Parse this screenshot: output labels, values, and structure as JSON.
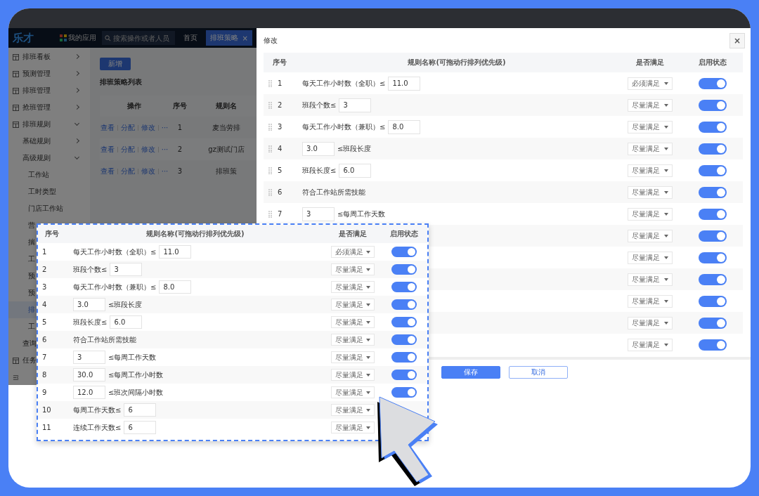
{
  "app": {
    "logo": "乐才",
    "apps_label": "我的应用",
    "search": {
      "placeholder": "搜索操作或者人员"
    },
    "nav_tabs": [
      {
        "label": "首页",
        "selected": false
      },
      {
        "label": "排班策略",
        "selected": true,
        "close": "×"
      }
    ],
    "sidebar": [
      {
        "label": "排班看板",
        "expanded": false
      },
      {
        "label": "预测管理",
        "expanded": false
      },
      {
        "label": "排班管理",
        "expanded": false
      },
      {
        "label": "抢班管理",
        "expanded": false
      },
      {
        "label": "排班规则",
        "expanded": true,
        "children": [
          {
            "label": "基础规则",
            "expanded": false
          },
          {
            "label": "高级规则",
            "expanded": true,
            "children": [
              {
                "label": "工作站",
                "selected": false
              },
              {
                "label": "工时类型",
                "selected": false
              },
              {
                "label": "门店工作站",
                "selected": false
              },
              {
                "label": "营",
                "selected": false
              },
              {
                "label": "揣",
                "selected": false
              },
              {
                "label": "工",
                "selected": false
              },
              {
                "label": "预",
                "selected": false
              },
              {
                "label": "预",
                "selected": false
              },
              {
                "label": "排",
                "selected": true
              },
              {
                "label": "工",
                "selected": false
              }
            ]
          },
          {
            "label": "查询"
          }
        ]
      },
      {
        "label": "任务"
      }
    ],
    "new_button": "新增",
    "list_title": "排班策略列表",
    "table": {
      "columns": [
        "操作",
        "序号",
        "规则名"
      ],
      "rows": [
        {
          "actions": [
            "查看",
            "分配",
            "修改",
            "···"
          ],
          "index": "1",
          "name": "麦当劳排"
        },
        {
          "actions": [
            "查看",
            "分配",
            "修改",
            "···"
          ],
          "index": "2",
          "name": "gz测试门店"
        },
        {
          "actions": [
            "查看",
            "分配",
            "修改",
            "···"
          ],
          "index": "3",
          "name": "排班策"
        }
      ]
    }
  },
  "modal": {
    "title": "修改",
    "close": "×",
    "columns": [
      "序号",
      "规则名称(可拖动行排列优先级)",
      "是否满足",
      "启用状态"
    ],
    "rows": [
      {
        "index": "1",
        "name": [
          {
            "kind": "text",
            "text": "每天工作小时数（全职）≤"
          },
          {
            "kind": "input",
            "text": "11.0"
          }
        ],
        "satisfy": "必须满足",
        "enabled": true
      },
      {
        "index": "2",
        "name": [
          {
            "kind": "text",
            "text": "班段个数≤"
          },
          {
            "kind": "input",
            "text": "3"
          }
        ],
        "satisfy": "尽量满足",
        "enabled": true
      },
      {
        "index": "3",
        "name": [
          {
            "kind": "text",
            "text": "每天工作小时数（兼职）≤"
          },
          {
            "kind": "input",
            "text": "8.0"
          }
        ],
        "satisfy": "尽量满足",
        "enabled": true
      },
      {
        "index": "4",
        "name": [
          {
            "kind": "input",
            "text": "3.0"
          },
          {
            "kind": "text",
            "text": "≤班段长度"
          }
        ],
        "satisfy": "尽量满足",
        "enabled": true
      },
      {
        "index": "5",
        "name": [
          {
            "kind": "text",
            "text": "班段长度≤"
          },
          {
            "kind": "input",
            "text": "6.0"
          }
        ],
        "satisfy": "尽量满足",
        "enabled": true
      },
      {
        "index": "6",
        "name": [
          {
            "kind": "text",
            "text": "符合工作站所需技能"
          }
        ],
        "satisfy": "尽量满足",
        "enabled": true
      },
      {
        "index": "7",
        "name": [
          {
            "kind": "input",
            "text": "3"
          },
          {
            "kind": "text",
            "text": "≤每周工作天数"
          }
        ],
        "satisfy": "尽量满足",
        "enabled": true
      },
      {
        "satisfy": "尽量满足",
        "enabled": true
      },
      {
        "satisfy": "尽量满足",
        "enabled": true
      },
      {
        "satisfy": "尽量满足",
        "enabled": true
      },
      {
        "satisfy": "尽量满足",
        "enabled": true
      },
      {
        "satisfy": "尽量满足",
        "enabled": true
      },
      {
        "satisfy": "尽量满足",
        "enabled": true
      }
    ],
    "buttons": [
      {
        "label": "保存",
        "kind": "primary"
      },
      {
        "label": "取消",
        "kind": "default"
      }
    ]
  },
  "callout": {
    "columns": [
      "序号",
      "规则名称(可拖动行排列优先级)",
      "是否满足",
      "启用状态"
    ],
    "rows": [
      {
        "index": "1",
        "name": [
          {
            "kind": "text",
            "text": "每天工作小时数（全职）≤"
          },
          {
            "kind": "input",
            "text": "11.0"
          }
        ],
        "satisfy": "必须满足",
        "enabled": true
      },
      {
        "index": "2",
        "name": [
          {
            "kind": "text",
            "text": "班段个数≤"
          },
          {
            "kind": "input",
            "text": "3"
          }
        ],
        "satisfy": "尽量满足",
        "enabled": true
      },
      {
        "index": "3",
        "name": [
          {
            "kind": "text",
            "text": "每天工作小时数（兼职）≤"
          },
          {
            "kind": "input",
            "text": "8.0"
          }
        ],
        "satisfy": "尽量满足",
        "enabled": true
      },
      {
        "index": "4",
        "name": [
          {
            "kind": "input",
            "text": "3.0"
          },
          {
            "kind": "text",
            "text": "≤班段长度"
          }
        ],
        "satisfy": "尽量满足",
        "enabled": true
      },
      {
        "index": "5",
        "name": [
          {
            "kind": "text",
            "text": "班段长度≤"
          },
          {
            "kind": "input",
            "text": "6.0"
          }
        ],
        "satisfy": "尽量满足",
        "enabled": true
      },
      {
        "index": "6",
        "name": [
          {
            "kind": "text",
            "text": "符合工作站所需技能"
          }
        ],
        "satisfy": "尽量满足",
        "enabled": true
      },
      {
        "index": "7",
        "name": [
          {
            "kind": "input",
            "text": "3"
          },
          {
            "kind": "text",
            "text": "≤每周工作天数"
          }
        ],
        "satisfy": "尽量满足",
        "enabled": true
      },
      {
        "index": "8",
        "name": [
          {
            "kind": "input",
            "text": "30.0"
          },
          {
            "kind": "text",
            "text": "≤每周工作小时数"
          }
        ],
        "satisfy": "尽量满足",
        "enabled": true
      },
      {
        "index": "9",
        "name": [
          {
            "kind": "input",
            "text": "12.0"
          },
          {
            "kind": "text",
            "text": "≤班次间隔小时数"
          }
        ],
        "satisfy": "尽量满足",
        "enabled": true
      },
      {
        "index": "10",
        "name": [
          {
            "kind": "text",
            "text": "每周工作天数≤"
          },
          {
            "kind": "input",
            "text": "6"
          }
        ],
        "satisfy": "尽量满足"
      },
      {
        "index": "11",
        "name": [
          {
            "kind": "text",
            "text": "连续工作天数≤"
          },
          {
            "kind": "input",
            "text": "6"
          }
        ],
        "satisfy": "尽量满足"
      }
    ]
  }
}
